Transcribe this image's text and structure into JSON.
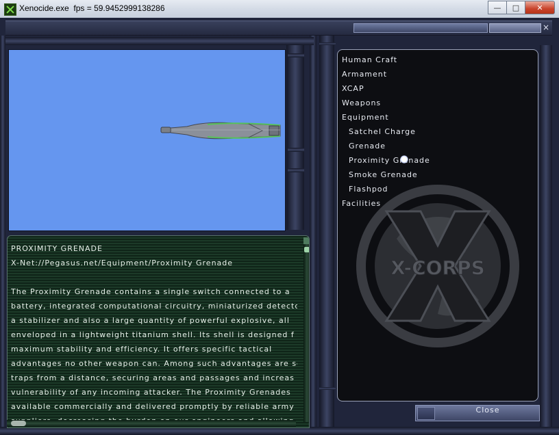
{
  "window": {
    "title": "Xenocide.exe  fps = 59.9452999138286",
    "minimize_glyph": "—",
    "maximize_glyph": "□",
    "close_glyph": "✕"
  },
  "panel_close_glyph": "×",
  "info": {
    "heading": "PROXIMITY GRENADE",
    "path": "X-Net://Pegasus.net/Equipment/Proximity Grenade",
    "body_lines": [
      "",
      "The Proximity Grenade contains a single switch connected to a",
      "battery, integrated computational circuitry, miniaturized detecto",
      "a stabilizer and also a large quantity of powerful explosive, all",
      "enveloped in a lightweight titanium shell. Its shell is designed f",
      "maximum stability and efficiency. It offers specific tactical",
      "advantages no other weapon can. Among such advantages are se",
      "traps from a distance, securing areas and passages and increas",
      "vulnerability of any incoming attacker. The Proximity Grenades",
      "available commercially and delivered promptly by reliable army",
      "suppliers, decreasing the burden on our engineers and allowing"
    ]
  },
  "tree": {
    "items": [
      {
        "label": "Human Craft",
        "level": 0
      },
      {
        "label": "Armament",
        "level": 0
      },
      {
        "label": "XCAP",
        "level": 0
      },
      {
        "label": "Weapons",
        "level": 0
      },
      {
        "label": "Equipment",
        "level": 0
      },
      {
        "label": "Satchel Charge",
        "level": 1
      },
      {
        "label": "Grenade",
        "level": 1
      },
      {
        "label": "Proximity Grenade",
        "level": 1
      },
      {
        "label": "Smoke Grenade",
        "level": 1
      },
      {
        "label": "Flashpod",
        "level": 1
      },
      {
        "label": "Facilities",
        "level": 0
      }
    ]
  },
  "logo": {
    "text": "X-CORPS"
  },
  "footer": {
    "close_label": "Close"
  },
  "colors": {
    "viewport_bg": "#6596ef",
    "info_bg": "#0f2418",
    "accent_green": "#57c15a"
  }
}
